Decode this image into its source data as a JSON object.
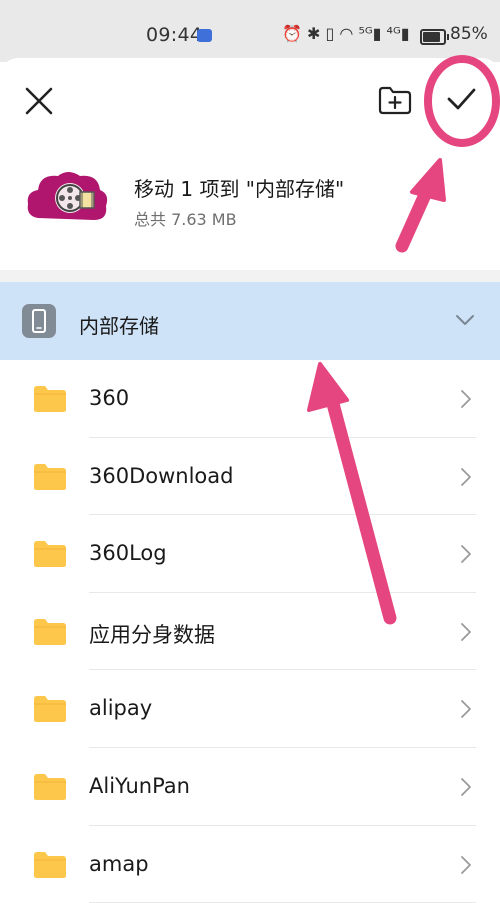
{
  "status_bar": {
    "time": "09:44",
    "indicators": "⏰ ✱ ▯ ◠ ⁵ᴳ▮ ⁴ᴳ▮",
    "battery_percent": "85%",
    "battery_level": 0.85
  },
  "dialog": {
    "move_title": "移动 1 项到 \"内部存储\"",
    "total_size": "总共 7.63 MB",
    "icons": {
      "close": "close-icon",
      "new_folder": "new-folder-icon",
      "confirm": "checkmark-icon"
    }
  },
  "storage": {
    "label": "内部存储",
    "icon": "phone-icon"
  },
  "folders": [
    {
      "name": "360"
    },
    {
      "name": "360Download"
    },
    {
      "name": "360Log"
    },
    {
      "name": "应用分身数据"
    },
    {
      "name": "alipay"
    },
    {
      "name": "AliYunPan"
    },
    {
      "name": "amap"
    }
  ],
  "colors": {
    "selected_row": "#cfe3f8",
    "folder": "#fcc74a",
    "annotation": "#e5467f"
  }
}
